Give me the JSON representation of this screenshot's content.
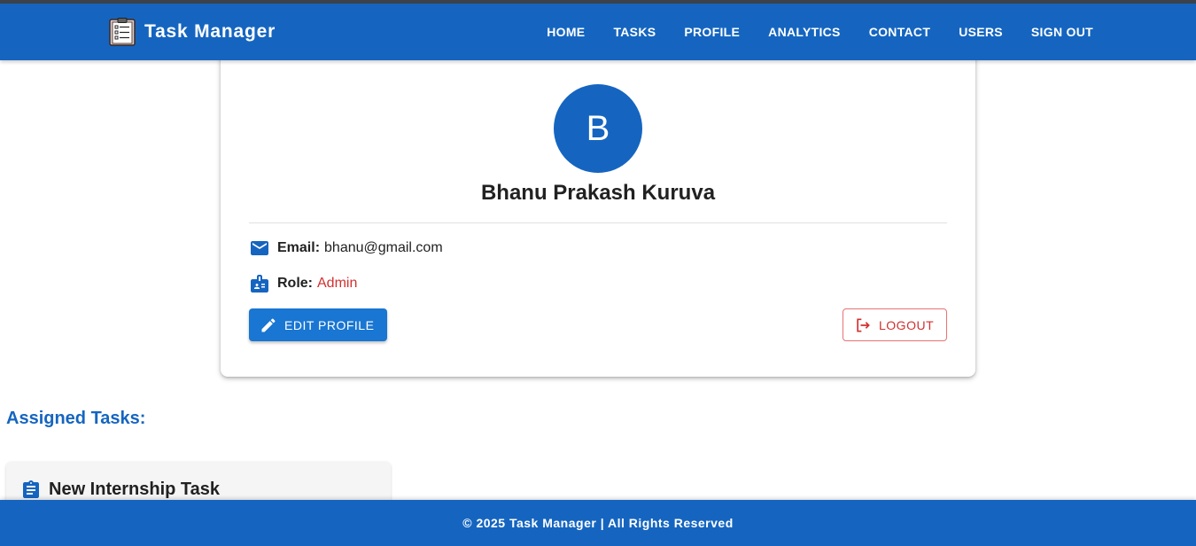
{
  "app": {
    "title": "Task Manager",
    "logo_icon": "clipboard-checklist-icon"
  },
  "nav": {
    "items": [
      {
        "label": "HOME"
      },
      {
        "label": "TASKS"
      },
      {
        "label": "PROFILE"
      },
      {
        "label": "ANALYTICS"
      },
      {
        "label": "CONTACT"
      },
      {
        "label": "USERS"
      },
      {
        "label": "SIGN OUT"
      }
    ]
  },
  "profile": {
    "avatar_initial": "B",
    "name": "Bhanu Prakash Kuruva",
    "email_label": "Email:",
    "email_value": "bhanu@gmail.com",
    "email_icon": "mail-icon",
    "role_label": "Role:",
    "role_value": "Admin",
    "role_icon": "badge-icon",
    "edit_button_label": "EDIT PROFILE",
    "edit_icon": "pencil-icon",
    "logout_button_label": "LOGOUT",
    "logout_icon": "logout-icon"
  },
  "tasks": {
    "heading": "Assigned Tasks:",
    "items": [
      {
        "title": "New Internship Task",
        "icon": "assignment-icon"
      }
    ]
  },
  "footer": {
    "text": "© 2025 Task Manager | All Rights Reserved"
  },
  "colors": {
    "primary": "#1565c0",
    "button_blue": "#1976d2",
    "danger": "#d32f2f",
    "card_bg": "#ffffff",
    "task_card_bg": "#f5f5f5"
  }
}
